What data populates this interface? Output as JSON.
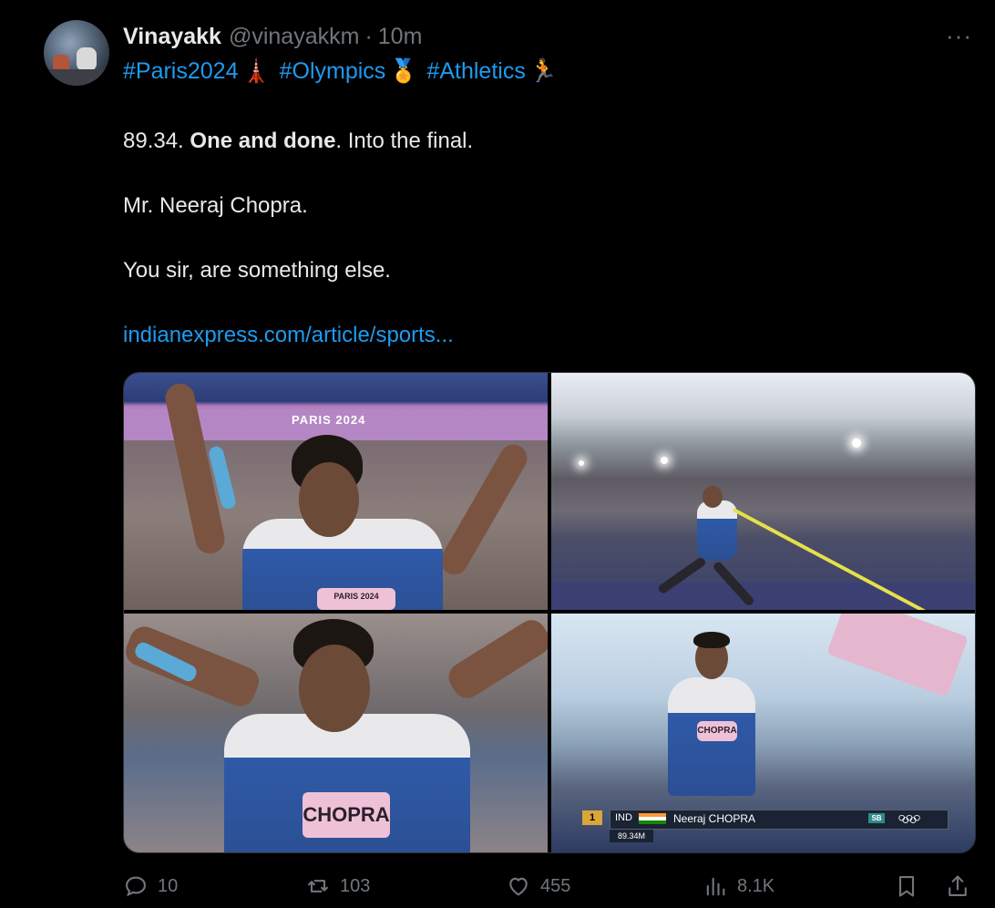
{
  "author": {
    "name": "Vinayakk",
    "handle": "@vinayakkm",
    "separator": "·",
    "time": "10m",
    "more_label": "···"
  },
  "hashtags": [
    {
      "text": "#Paris2024",
      "emoji": "🗼"
    },
    {
      "text": "#Olympics",
      "emoji": "🏅"
    },
    {
      "text": "#Athletics",
      "emoji": "🏃"
    }
  ],
  "post": {
    "line1_number": "89.34.",
    "line1_bold": "One and done",
    "line1_rest": ". Into the final.",
    "line2": "Mr. Neeraj Chopra.",
    "line3": "You sir, are something else.",
    "link": "indianexpress.com/article/sports..."
  },
  "media": {
    "banner_text": "PARIS 2024",
    "bib_label": "CHOPRA",
    "bib_small": "PARIS 2024",
    "graphic": {
      "rank": "1",
      "country": "IND",
      "athlete": "Neeraj CHOPRA",
      "badge": "SB",
      "mark": "89.34M"
    }
  },
  "actions": {
    "replies": {
      "icon": "reply-icon",
      "count": "10"
    },
    "reposts": {
      "icon": "repost-icon",
      "count": "103"
    },
    "likes": {
      "icon": "heart-icon",
      "count": "455"
    },
    "views": {
      "icon": "views-icon",
      "count": "8.1K"
    },
    "bookmark": {
      "icon": "bookmark-icon"
    },
    "share": {
      "icon": "share-icon"
    }
  },
  "colors": {
    "background": "#000000",
    "text": "#e7e9ea",
    "muted": "#71767b",
    "accent": "#1d9bf0"
  }
}
